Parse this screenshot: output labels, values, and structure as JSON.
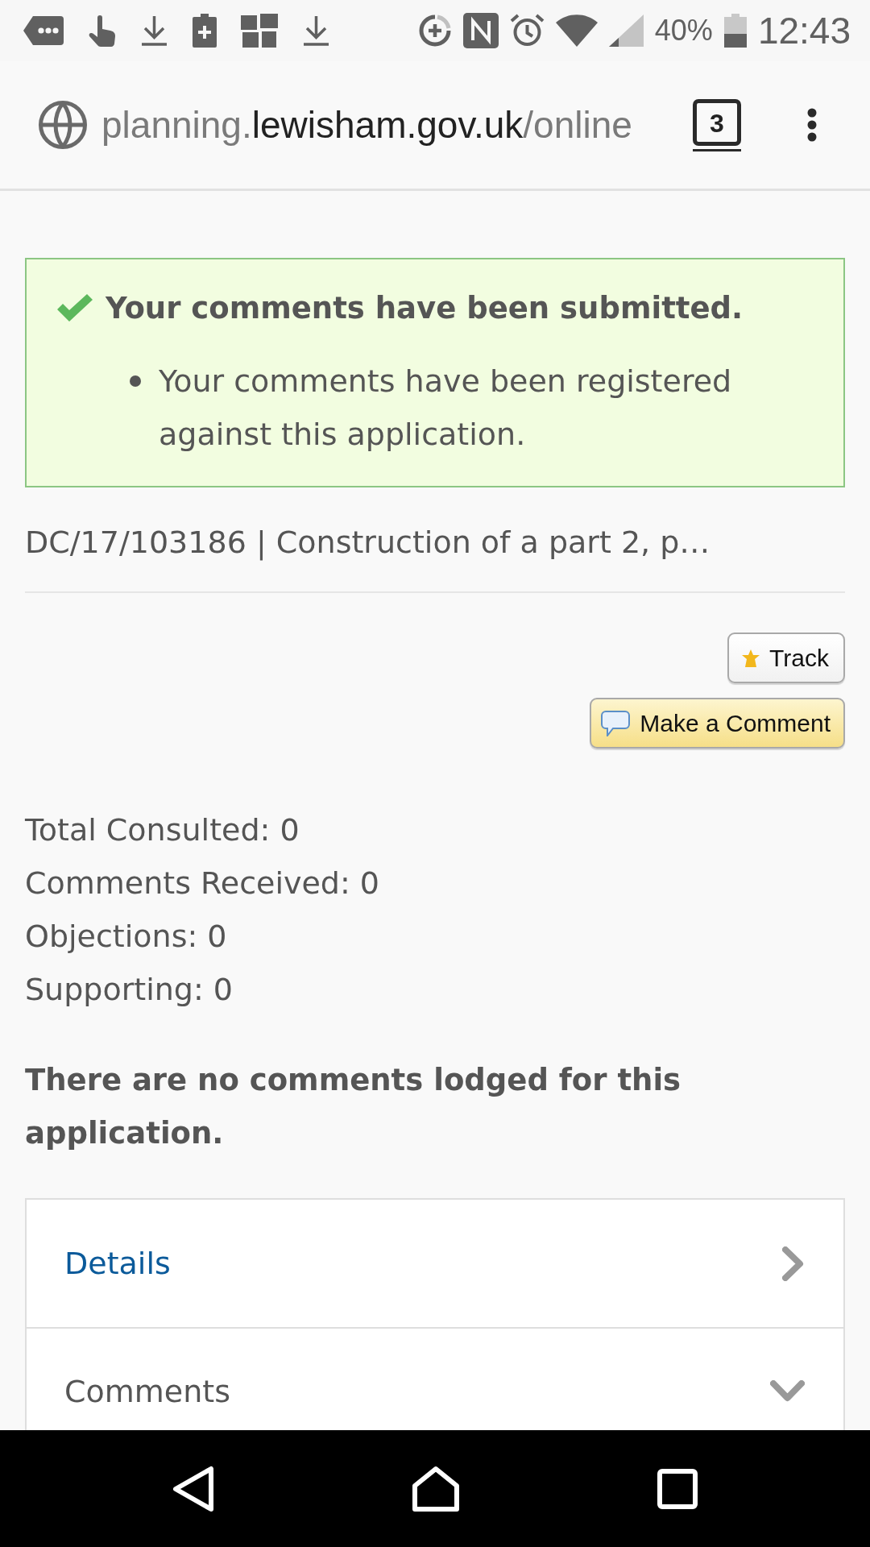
{
  "status_bar": {
    "battery_text": "40%",
    "time": "12:43"
  },
  "browser": {
    "url": {
      "subdomain": "planning.",
      "domain": "lewisham.gov.uk",
      "path": "/online"
    },
    "tab_count": "3"
  },
  "alert": {
    "kind": "success",
    "title": "Your comments have been submitted.",
    "items": [
      "Your comments have been registered against this application."
    ]
  },
  "application_heading": "DC/17/103186 | Construction of a part 2, p…",
  "buttons": [
    {
      "kind": "track",
      "label": "Track"
    },
    {
      "kind": "comment",
      "label": "Make a Comment"
    }
  ],
  "stats": [
    "Total Consulted: 0",
    "Comments Received: 0",
    "Objections: 0",
    "Supporting: 0"
  ],
  "notice": "There are no comments lodged for this application.",
  "sections": [
    {
      "kind": "link",
      "label": "Details"
    },
    {
      "kind": "toggle",
      "label": "Comments"
    }
  ]
}
